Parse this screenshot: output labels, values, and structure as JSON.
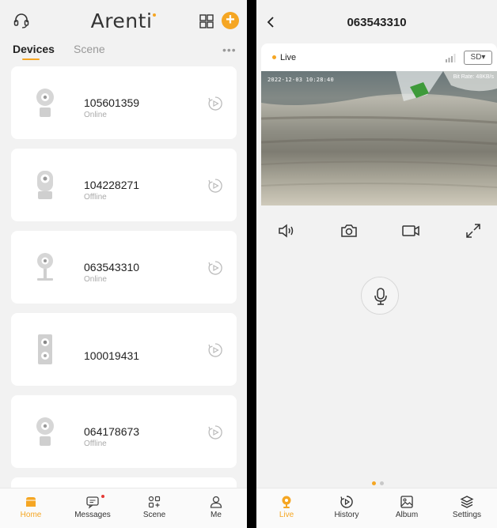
{
  "home": {
    "brand": "Arenti",
    "tabs": [
      "Devices",
      "Scene"
    ],
    "more": "•••",
    "add_label": "+",
    "devices": [
      {
        "name": "105601359",
        "status": "Online",
        "icon": "dome-camera-icon"
      },
      {
        "name": "104228271",
        "status": "Offline",
        "icon": "pan-tilt-camera-icon"
      },
      {
        "name": "063543310",
        "status": "Online",
        "icon": "stand-camera-icon"
      },
      {
        "name": "100019431",
        "status": "",
        "icon": "doorbell-camera-icon"
      },
      {
        "name": "064178673",
        "status": "Offline",
        "icon": "dome-camera-icon"
      }
    ],
    "nav": [
      {
        "label": "Home",
        "icon": "home-icon",
        "active": true
      },
      {
        "label": "Messages",
        "icon": "messages-icon",
        "active": false
      },
      {
        "label": "Scene",
        "icon": "scene-icon",
        "active": false
      },
      {
        "label": "Me",
        "icon": "person-icon",
        "active": false
      }
    ]
  },
  "live": {
    "title": "063543310",
    "live_label": "Live",
    "quality": "SD▾",
    "timestamp": "2022-12-03 10:28:40",
    "bitrate": "Bit Rate: 48KB/s",
    "nav": [
      {
        "label": "Live",
        "icon": "live-camera-icon",
        "active": true
      },
      {
        "label": "History",
        "icon": "history-icon",
        "active": false
      },
      {
        "label": "Album",
        "icon": "album-icon",
        "active": false
      },
      {
        "label": "Settings",
        "icon": "settings-icon",
        "active": false
      }
    ]
  },
  "colors": {
    "accent": "#f5a623",
    "badge": "#e53935"
  }
}
